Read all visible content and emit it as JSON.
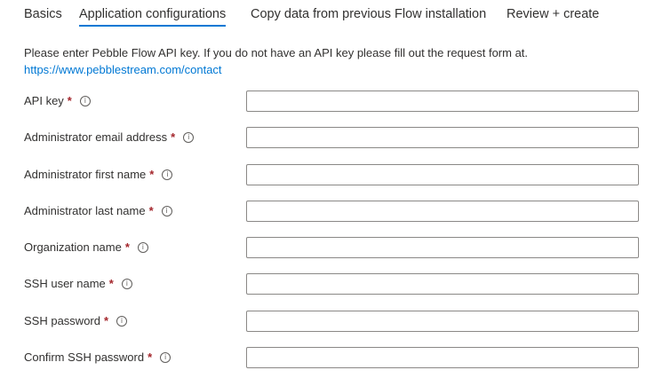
{
  "tabs": [
    {
      "label": "Basics",
      "active": false
    },
    {
      "label": "Application configurations",
      "active": true
    },
    {
      "label": "Copy data from previous Flow installation",
      "active": false
    },
    {
      "label": "Review + create",
      "active": false
    }
  ],
  "intro": {
    "text": "Please enter Pebble Flow API key. If you do not have an API key please fill out the request form at.",
    "link": "https://www.pebblestream.com/contact"
  },
  "fields": [
    {
      "label": "API key",
      "required": "*",
      "value": "",
      "placeholder": ""
    },
    {
      "label": "Administrator email address",
      "required": "*",
      "value": "",
      "placeholder": ""
    },
    {
      "label": "Administrator first name",
      "required": "*",
      "value": "",
      "placeholder": ""
    },
    {
      "label": "Administrator last name",
      "required": "*",
      "value": "",
      "placeholder": ""
    },
    {
      "label": "Organization name",
      "required": "*",
      "value": "",
      "placeholder": ""
    },
    {
      "label": "SSH user name",
      "required": "*",
      "value": "",
      "placeholder": ""
    },
    {
      "label": "SSH password",
      "required": "*",
      "value": "",
      "placeholder": ""
    },
    {
      "label": "Confirm SSH password",
      "required": "*",
      "value": "",
      "placeholder": ""
    }
  ],
  "colors": {
    "accent": "#0078d4",
    "required": "#a4262c",
    "border": "#8a8886"
  }
}
